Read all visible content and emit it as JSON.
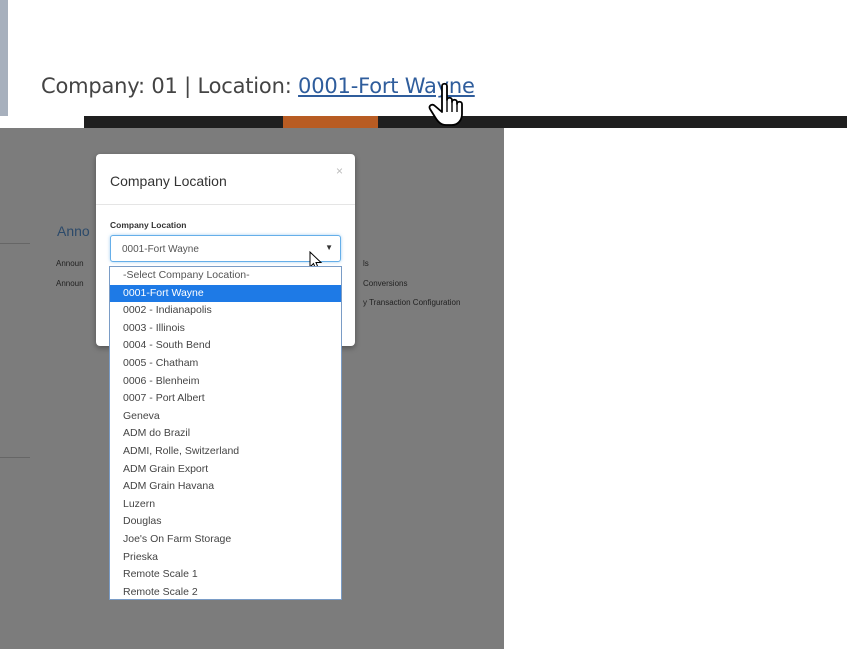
{
  "header": {
    "company_text": "Company: 01 | Location: ",
    "location_link": "0001-Fort Wayne"
  },
  "background": {
    "section_title": "Anno",
    "left_items": [
      "Announ",
      "Announ"
    ],
    "right_items": [
      "ls",
      "Conversions",
      "y Transaction Configuration"
    ]
  },
  "modal": {
    "title": "Company Location",
    "close_glyph": "×",
    "field_label": "Company Location",
    "selected_value": "0001-Fort Wayne",
    "arrow_glyph": "▼"
  },
  "dropdown": {
    "options": [
      "-Select Company Location-",
      "0001-Fort Wayne",
      "0002 - Indianapolis",
      "0003 - Illinois",
      "0004 - South Bend",
      "0005 - Chatham",
      "0006 - Blenheim",
      "0007 - Port Albert",
      "Geneva",
      "ADM do Brazil",
      "ADMI, Rolle, Switzerland",
      "ADM Grain Export",
      "ADM Grain Havana",
      "Luzern",
      "Douglas",
      "Joe's On Farm Storage",
      "Prieska",
      "Remote Scale 1",
      "Remote Scale 2"
    ],
    "selected_index": 1
  },
  "colors": {
    "link": "#2f5d9c",
    "selected_bg": "#1e7ae6",
    "overlay": "#7c7c7c",
    "accent_orange": "#b85c23"
  },
  "icons": [
    "hand-pointer-icon",
    "arrow-cursor-icon",
    "close-icon",
    "dropdown-arrow-icon"
  ]
}
